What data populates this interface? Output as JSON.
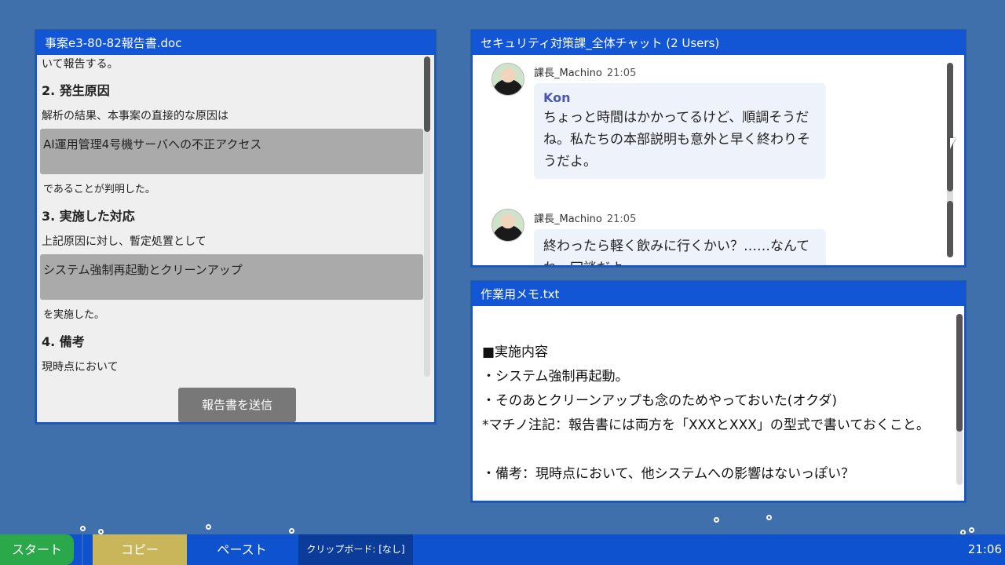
{
  "report_window": {
    "title": "事案e3-80-82報告書.doc",
    "line_intro": "いて報告する。",
    "section2_heading": "2. 発生原因",
    "section2_text": "解析の結果、本事案の直接的な原因は",
    "cause_slot": "AI運用管理4号機サーバへの不正アクセス",
    "section2_after": "であることが判明した。",
    "section3_heading": "3. 実施した対応",
    "section3_text": "上記原因に対し、暫定処置として",
    "action_slot": "システム強制再起動とクリーンアップ",
    "section3_after": "を実施した。",
    "section4_heading": "4. 備考",
    "section4_partial": "現時点において",
    "submit_label": "報告書を送信"
  },
  "chat_window": {
    "title": "セキュリティ対策課_全体チャット (2 Users)",
    "messages": [
      {
        "user": "課長_Machino",
        "time": "21:05",
        "mention": "Kon",
        "text": "ちょっと時間はかかってるけど、順調そうだね。私たちの本部説明も意外と早く終わりそうだよ。"
      },
      {
        "user": "課長_Machino",
        "time": "21:05",
        "text": "終わったら軽く飲みに行くかい？……なんてね。冗談だよ。"
      }
    ]
  },
  "memo_window": {
    "title": "作業用メモ.txt",
    "content": "■実施内容\n・システム強制再起動。\n・そのあとクリーンアップも念のためやっておいた(オクダ)\n*マチノ注記：報告書には両方を「XXXとXXX」の型式で書いておくこと。\n\n・備考：現時点において、他システムへの影響はないっぽい？"
  },
  "taskbar": {
    "start_label": "スタート",
    "copy_label": "コピー",
    "paste_label": "ペースト",
    "clipboard_label": "クリップボード: [なし]",
    "clock": "21:06"
  },
  "colors": {
    "desktop": "#3f70ab",
    "titlebar": "#1256d6",
    "start": "#2aa84a",
    "copy": "#c9b65a",
    "slot": "#aaaaaa"
  }
}
